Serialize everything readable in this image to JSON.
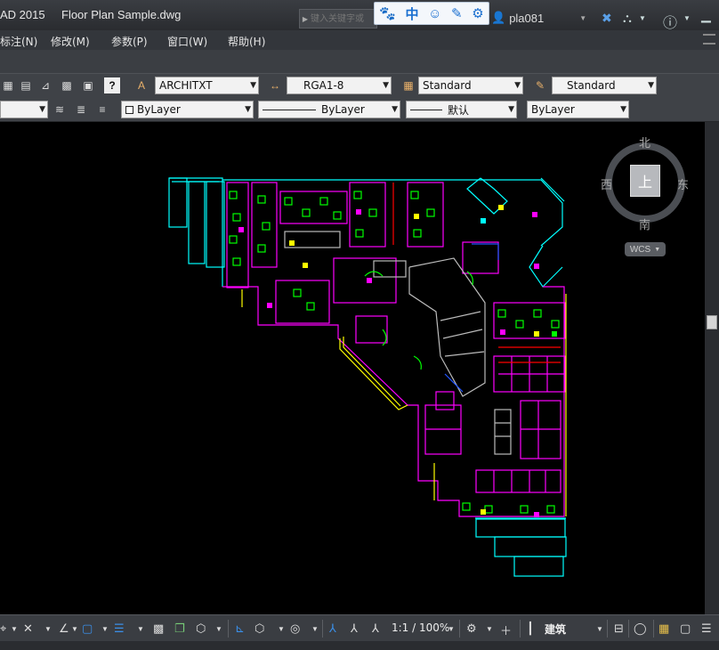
{
  "titlebar": {
    "app_title": "AD 2015",
    "doc_title": "Floor Plan Sample.dwg",
    "search_placeholder": "键入关键字或",
    "ime": [
      "🐾",
      "中",
      "☺",
      "✎",
      "⚙"
    ],
    "username": "pla081"
  },
  "menu": [
    "标注(N)",
    "修改(M)",
    "参数(P)",
    "窗口(W)",
    "帮助(H)"
  ],
  "toolbar1": {
    "text_style": "ARCHITXT",
    "dim_style": "RGA1-8",
    "table_style": "Standard",
    "multileader_style": "Standard"
  },
  "toolbar2": {
    "color": "ByLayer",
    "linetype": "ByLayer",
    "lineweight": "默认",
    "plotstyle": "ByLayer"
  },
  "viewcube": {
    "north": "北",
    "south": "南",
    "east": "东",
    "west": "西",
    "face": "上",
    "wcs": "WCS"
  },
  "statusbar": {
    "scale": "1:1 / 100%",
    "workspace": "建筑"
  },
  "colors": {
    "cyan": "#00ffff",
    "magenta": "#ff00ff",
    "yellow": "#ffff00",
    "green": "#00ff00",
    "red": "#ff0000",
    "white": "#ffffff",
    "blue": "#2255ff"
  }
}
